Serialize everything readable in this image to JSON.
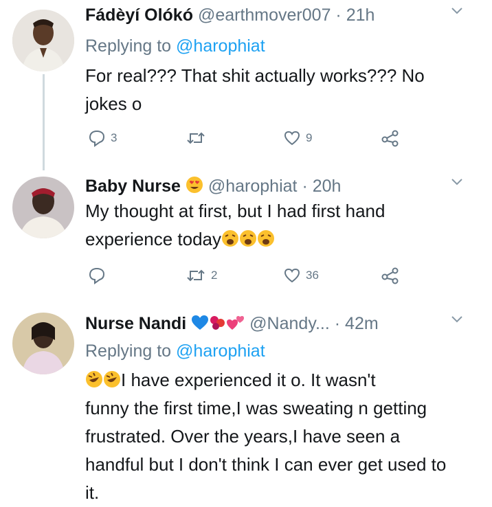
{
  "tweets": [
    {
      "name": "Fádèyí Olókó",
      "handle": "@earthmover007",
      "sep": "·",
      "time": "21h",
      "replying_label": "Replying to",
      "replying_handle": "@harophiat",
      "text": "For real??? That shit actually works??? No jokes o",
      "replies": "3",
      "retweets": "",
      "likes": "9"
    },
    {
      "name": "Baby Nurse",
      "handle": "@harophiat",
      "sep": "·",
      "time": "20h",
      "text_line1": "My thought at first, but I had first hand",
      "text_line2": "experience today",
      "replies": "",
      "retweets": "2",
      "likes": "36"
    },
    {
      "name": "Nurse Nandi",
      "handle": "@Nandy...",
      "sep": "·",
      "time": "42m",
      "replying_label": "Replying to",
      "replying_handle": "@harophiat",
      "text_line1": "I have experienced it o. It wasn't",
      "text_rest": "funny the first time,I was sweating n getting frustrated. Over the years,I have seen a handful but I don't think I can ever get used to it."
    }
  ],
  "colors": {
    "link": "#1da1f2",
    "muted": "#657786",
    "text": "#14171a"
  }
}
